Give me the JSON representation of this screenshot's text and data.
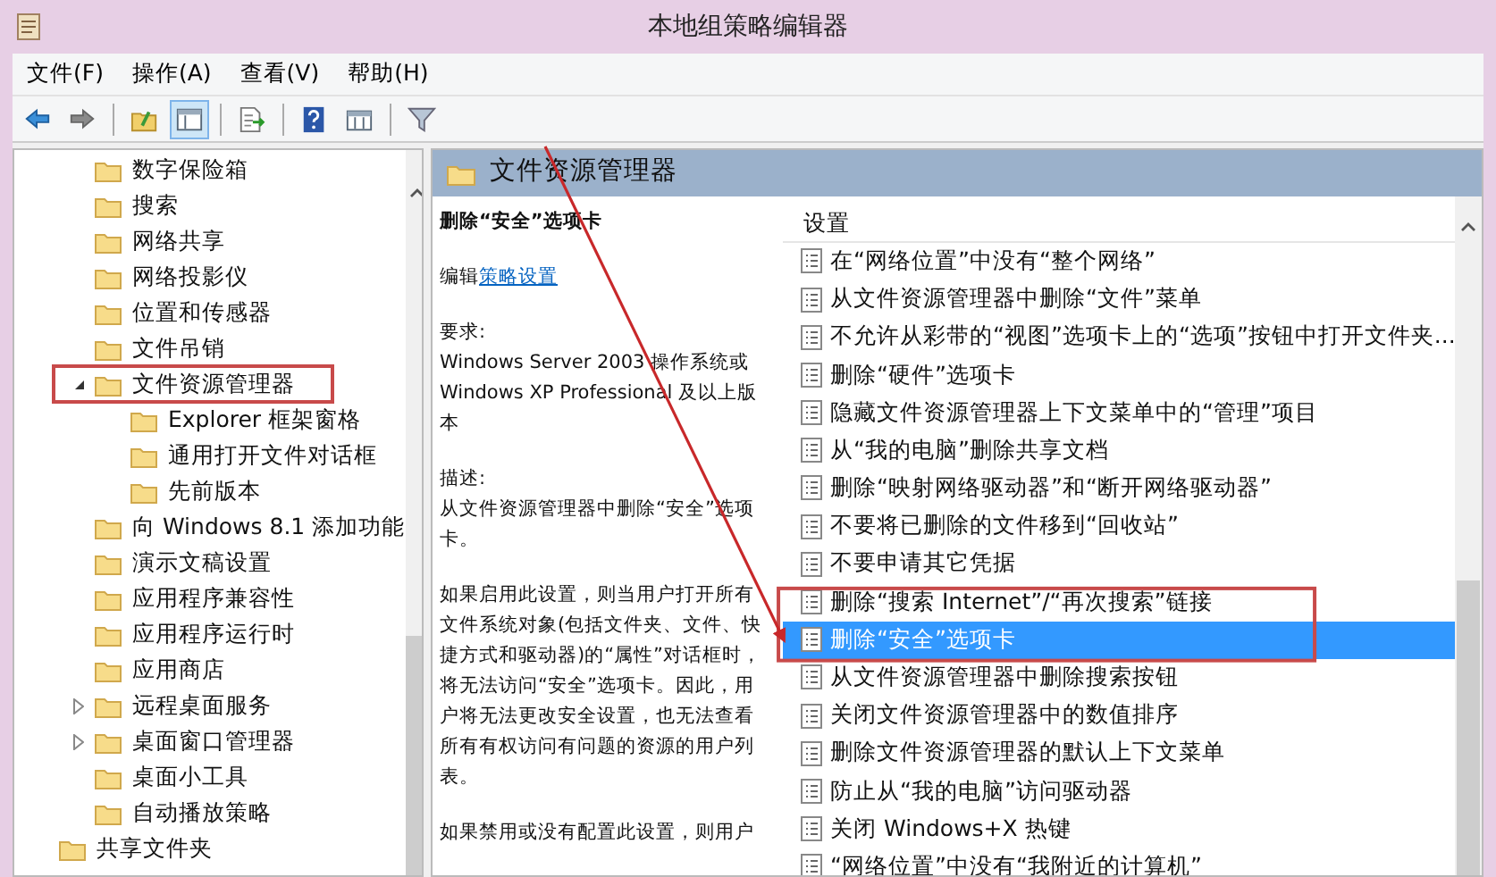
{
  "window": {
    "title": "本地组策略编辑器"
  },
  "menu": [
    "文件(F)",
    "操作(A)",
    "查看(V)",
    "帮助(H)"
  ],
  "toolbar": [
    {
      "kind": "back"
    },
    {
      "kind": "forward"
    },
    {
      "kind": "sep"
    },
    {
      "kind": "up"
    },
    {
      "kind": "panel",
      "selected": true
    },
    {
      "kind": "sep"
    },
    {
      "kind": "export"
    },
    {
      "kind": "sep"
    },
    {
      "kind": "help"
    },
    {
      "kind": "view"
    },
    {
      "kind": "sep"
    },
    {
      "kind": "filter"
    }
  ],
  "tree": {
    "items": [
      {
        "label": "数字保险箱"
      },
      {
        "label": "搜索"
      },
      {
        "label": "网络共享"
      },
      {
        "label": "网络投影仪"
      },
      {
        "label": "位置和传感器"
      },
      {
        "label": "文件吊销"
      },
      {
        "label": "文件资源管理器",
        "expanded": true,
        "children": [
          {
            "label": "Explorer 框架窗格"
          },
          {
            "label": "通用打开文件对话框"
          },
          {
            "label": "先前版本"
          }
        ]
      },
      {
        "label": "向 Windows 8.1 添加功能"
      },
      {
        "label": "演示文稿设置"
      },
      {
        "label": "应用程序兼容性"
      },
      {
        "label": "应用程序运行时"
      },
      {
        "label": "应用商店"
      },
      {
        "label": "远程桌面服务",
        "expanded": false
      },
      {
        "label": "桌面窗口管理器",
        "expanded": false
      },
      {
        "label": "桌面小工具"
      },
      {
        "label": "自动播放策略"
      }
    ],
    "after": [
      {
        "label": "共享文件夹"
      }
    ]
  },
  "pane": {
    "title": "文件资源管理器",
    "details": {
      "heading": "删除“安全”选项卡",
      "edit_prefix": "编辑",
      "edit_link": "策略设置",
      "req_label": "要求:",
      "requirement": "Windows Server 2003 操作系统或 Windows XP Professional 及以上版本",
      "desc_label": "描述:",
      "description": "从文件资源管理器中删除“安全”选项卡。",
      "paragraphs": [
        "如果启用此设置，则当用户打开所有文件系统对象(包括文件夹、文件、快捷方式和驱动器)的“属性”对话框时，将无法访问“安全”选项卡。因此，用户将无法更改安全设置，也无法查看所有有权访问有问题的资源的用户列表。",
        "如果禁用或没有配置此设置，则用户"
      ]
    },
    "column": "设置",
    "settings": [
      {
        "label": "在“网络位置”中没有“整个网络”",
        "selected": false
      },
      {
        "label": "从文件资源管理器中删除“文件”菜单",
        "selected": false
      },
      {
        "label": "不允许从彩带的“视图”选项卡上的“选项”按钮中打开文件夹...",
        "selected": false
      },
      {
        "label": "删除“硬件”选项卡",
        "selected": false
      },
      {
        "label": "隐藏文件资源管理器上下文菜单中的“管理”项目",
        "selected": false
      },
      {
        "label": "从“我的电脑”删除共享文档",
        "selected": false
      },
      {
        "label": "删除“映射网络驱动器”和“断开网络驱动器”",
        "selected": false
      },
      {
        "label": "不要将已删除的文件移到“回收站”",
        "selected": false
      },
      {
        "label": "不要申请其它凭据",
        "selected": false
      },
      {
        "label": "删除“搜索 Internet”/“再次搜索”链接",
        "selected": false
      },
      {
        "label": "删除“安全”选项卡",
        "selected": true
      },
      {
        "label": "从文件资源管理器中删除搜索按钮",
        "selected": false
      },
      {
        "label": "关闭文件资源管理器中的数值排序",
        "selected": false
      },
      {
        "label": "删除文件资源管理器的默认上下文菜单",
        "selected": false
      },
      {
        "label": "防止从“我的电脑”访问驱动器",
        "selected": false
      },
      {
        "label": "关闭 Windows+X 热键",
        "selected": false
      },
      {
        "label": "“网络位置”中没有“我附近的计算机”",
        "selected": false
      }
    ]
  }
}
